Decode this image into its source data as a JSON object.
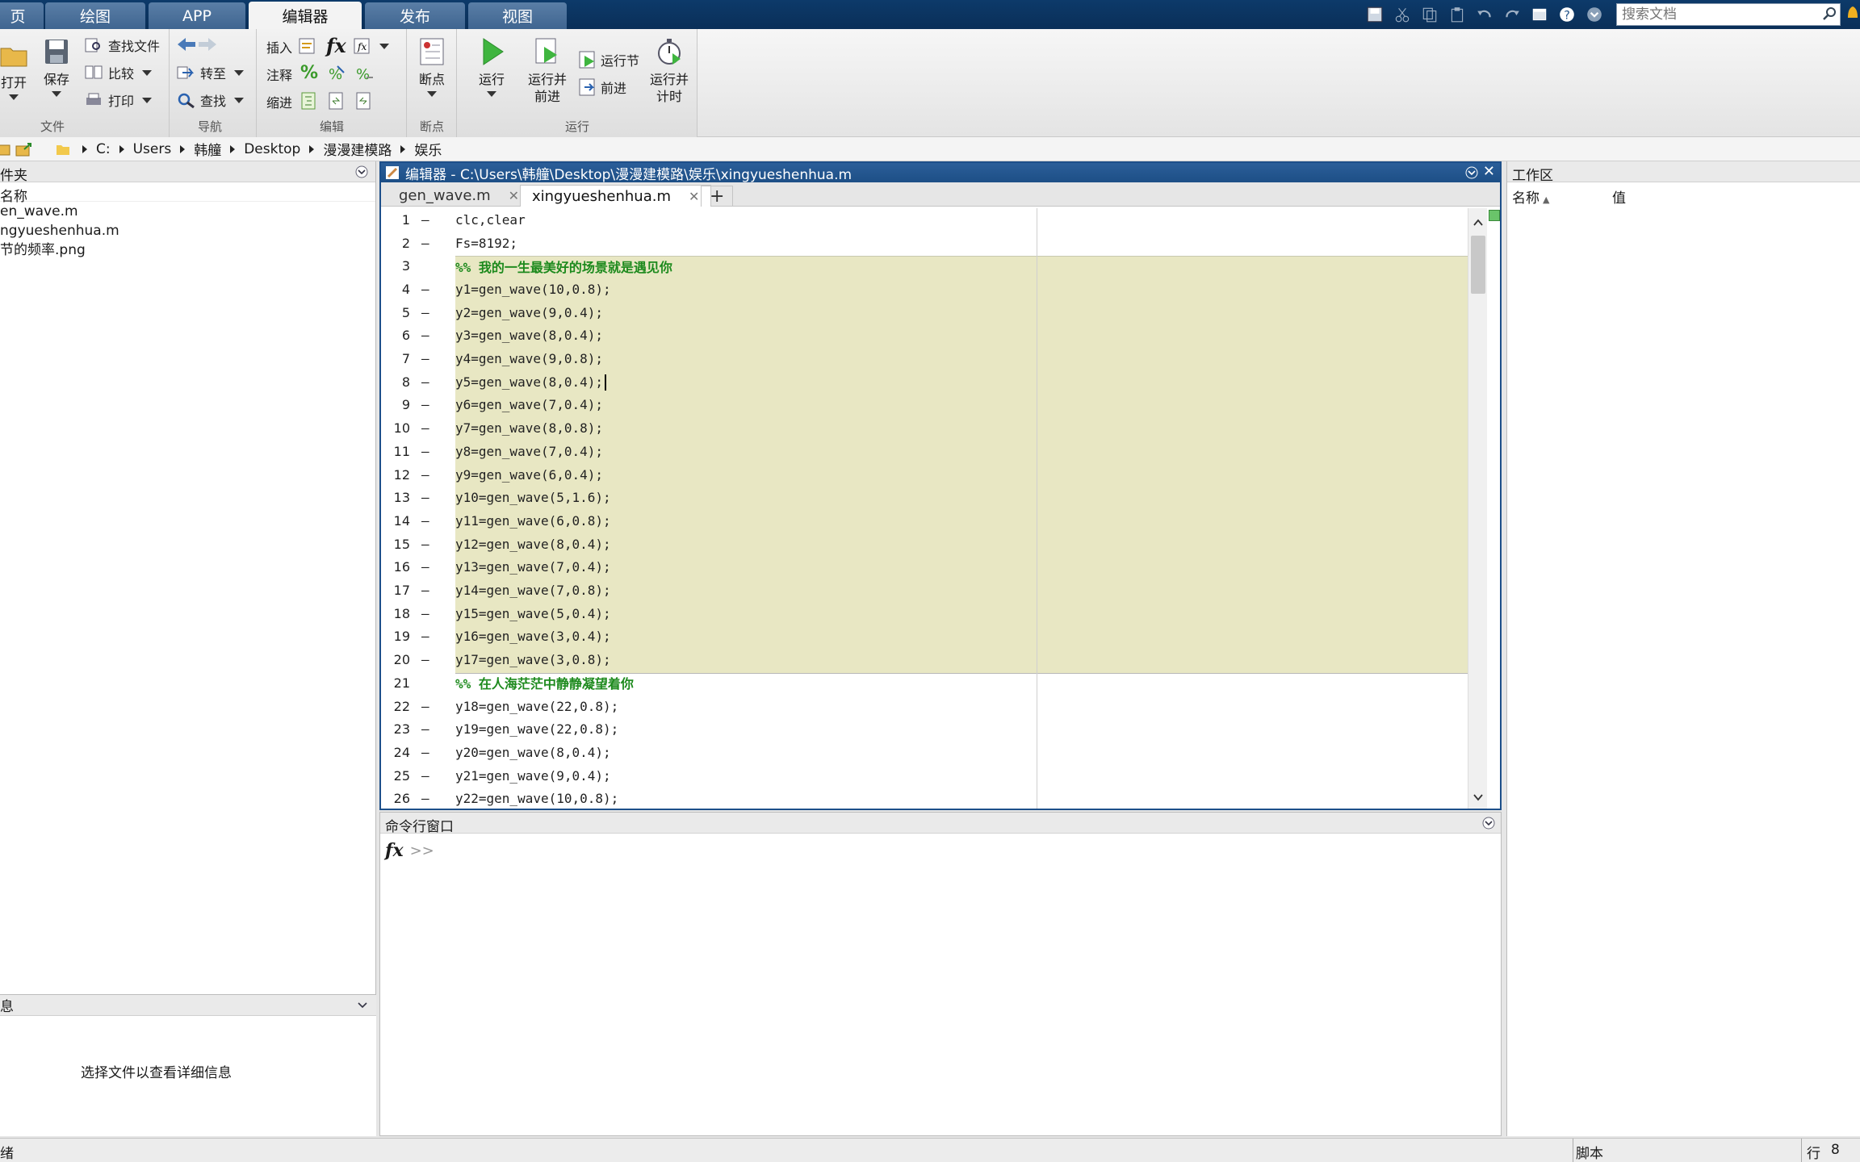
{
  "ribbon_tabs": [
    "页",
    "绘图",
    "APP",
    "编辑器",
    "发布",
    "视图"
  ],
  "active_tab": "编辑器",
  "search": {
    "placeholder": "搜索文档"
  },
  "ribbon": {
    "file": {
      "open": "打开",
      "save": "保存",
      "find_files": "查找文件",
      "compare": "比较",
      "print": "打印",
      "label": "文件"
    },
    "nav": {
      "goto": "转至",
      "find": "查找",
      "label": "导航"
    },
    "edit": {
      "insert": "插入",
      "comment": "注释",
      "indent": "缩进",
      "label": "编辑"
    },
    "breakpoints": {
      "breakpoints": "断点",
      "label": "断点"
    },
    "run": {
      "run": "运行",
      "run_advance": "运行并\n前进",
      "run_section": "运行节",
      "advance": "前进",
      "run_time": "运行并\n计时",
      "label": "运行"
    }
  },
  "address": [
    "C:",
    "Users",
    "韩艟",
    "Desktop",
    "漫漫建模路",
    "娱乐"
  ],
  "current_folder": {
    "title": "件夹",
    "col_name": "名称",
    "files": [
      "en_wave.m",
      "ngyueshenhua.m",
      "节的频率.png"
    ]
  },
  "details": {
    "title": "息",
    "message": "选择文件以查看详细信息"
  },
  "editor": {
    "title": "编辑器 - C:\\Users\\韩艟\\Desktop\\漫漫建模路\\娱乐\\xingyueshenhua.m",
    "tabs": [
      "gen_wave.m",
      "xingyueshenhua.m"
    ],
    "active_tab": "xingyueshenhua.m",
    "lines": [
      {
        "n": "1",
        "exec": true,
        "text": "clc,clear",
        "comment": false
      },
      {
        "n": "2",
        "exec": true,
        "text": "Fs=8192;",
        "comment": false
      },
      {
        "n": "3",
        "exec": false,
        "text": "%% 我的一生最美好的场景就是遇见你",
        "comment": true
      },
      {
        "n": "4",
        "exec": true,
        "text": "y1=gen_wave(10,0.8);",
        "comment": false
      },
      {
        "n": "5",
        "exec": true,
        "text": "y2=gen_wave(9,0.4);",
        "comment": false
      },
      {
        "n": "6",
        "exec": true,
        "text": "y3=gen_wave(8,0.4);",
        "comment": false
      },
      {
        "n": "7",
        "exec": true,
        "text": "y4=gen_wave(9,0.8);",
        "comment": false
      },
      {
        "n": "8",
        "exec": true,
        "text": "y5=gen_wave(8,0.4);",
        "comment": false
      },
      {
        "n": "9",
        "exec": true,
        "text": "y6=gen_wave(7,0.4);",
        "comment": false
      },
      {
        "n": "10",
        "exec": true,
        "text": "y7=gen_wave(8,0.8);",
        "comment": false
      },
      {
        "n": "11",
        "exec": true,
        "text": "y8=gen_wave(7,0.4);",
        "comment": false
      },
      {
        "n": "12",
        "exec": true,
        "text": "y9=gen_wave(6,0.4);",
        "comment": false
      },
      {
        "n": "13",
        "exec": true,
        "text": "y10=gen_wave(5,1.6);",
        "comment": false
      },
      {
        "n": "14",
        "exec": true,
        "text": "y11=gen_wave(6,0.8);",
        "comment": false
      },
      {
        "n": "15",
        "exec": true,
        "text": "y12=gen_wave(8,0.4);",
        "comment": false
      },
      {
        "n": "16",
        "exec": true,
        "text": "y13=gen_wave(7,0.4);",
        "comment": false
      },
      {
        "n": "17",
        "exec": true,
        "text": "y14=gen_wave(7,0.8);",
        "comment": false
      },
      {
        "n": "18",
        "exec": true,
        "text": "y15=gen_wave(5,0.4);",
        "comment": false
      },
      {
        "n": "19",
        "exec": true,
        "text": "y16=gen_wave(3,0.4);",
        "comment": false
      },
      {
        "n": "20",
        "exec": true,
        "text": "y17=gen_wave(3,0.8);",
        "comment": false
      },
      {
        "n": "21",
        "exec": false,
        "text": "%% 在人海茫茫中静静凝望着你",
        "comment": true
      },
      {
        "n": "22",
        "exec": true,
        "text": "y18=gen_wave(22,0.8);",
        "comment": false
      },
      {
        "n": "23",
        "exec": true,
        "text": "y19=gen_wave(22,0.8);",
        "comment": false
      },
      {
        "n": "24",
        "exec": true,
        "text": "y20=gen_wave(8,0.4);",
        "comment": false
      },
      {
        "n": "25",
        "exec": true,
        "text": "y21=gen_wave(9,0.4);",
        "comment": false
      },
      {
        "n": "26",
        "exec": true,
        "text": "y22=gen_wave(10,0.8);",
        "comment": false
      }
    ]
  },
  "command_window": {
    "title": "命令行窗口",
    "prompt": ">>"
  },
  "workspace": {
    "title": "工作区",
    "col_name": "名称",
    "col_value": "值"
  },
  "status": {
    "left": "绪",
    "mode": "脚本",
    "row_label": "行",
    "row": "8"
  },
  "colors": {
    "cell_highlight": "#e8e7c3",
    "comment": "#1d8a1d",
    "title_blue": "#1d4f86"
  }
}
